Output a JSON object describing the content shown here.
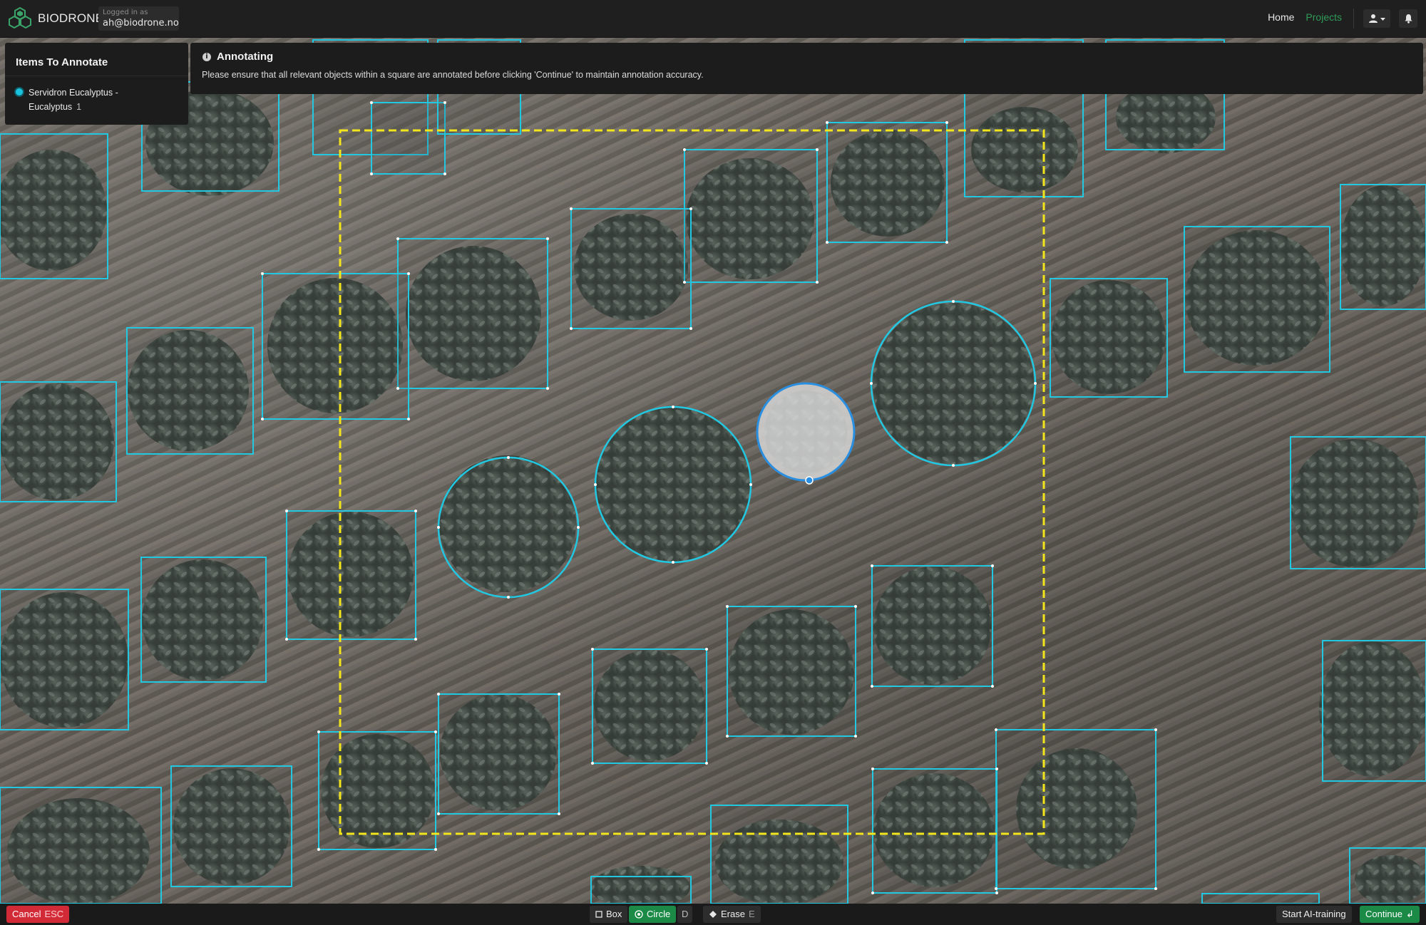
{
  "header": {
    "brand": "BIODRONE",
    "login_caption": "Logged in as",
    "login_email": "ah@biodrone.no",
    "nav": {
      "home": "Home",
      "projects": "Projects"
    },
    "colors": {
      "active_nav": "#2f9c58",
      "logo": "#3aa36a"
    },
    "icons": [
      "hexagon-logo-icon",
      "user-icon",
      "caret-down-icon",
      "bell-icon"
    ]
  },
  "items_panel": {
    "title": "Items To Annotate",
    "items": [
      {
        "name": "Servidron Eucalyptus - Eucalyptus",
        "count": "1",
        "color": "#19c3de"
      }
    ]
  },
  "info_panel": {
    "title": "Annotating",
    "message": "Please ensure that all relevant objects within a square are annotated before clicking 'Continue' to maintain annotation accuracy."
  },
  "toolbar": {
    "cancel": "Cancel",
    "cancel_key": "ESC",
    "box": "Box",
    "circle": "Circle",
    "circle_key": "D",
    "erase": "Erase",
    "erase_key": "E",
    "ai_training": "Start AI-training",
    "continue": "Continue",
    "continue_key": "↲",
    "active_tool": "Circle",
    "colors": {
      "cancel": "#d32a37",
      "active": "#1b8a47"
    }
  },
  "annotation_colors": {
    "box": "#22c8e2",
    "circle": "#22c8e2",
    "selected_fill": "#d9d9d9",
    "tile_boundary": "#f2e51b"
  }
}
